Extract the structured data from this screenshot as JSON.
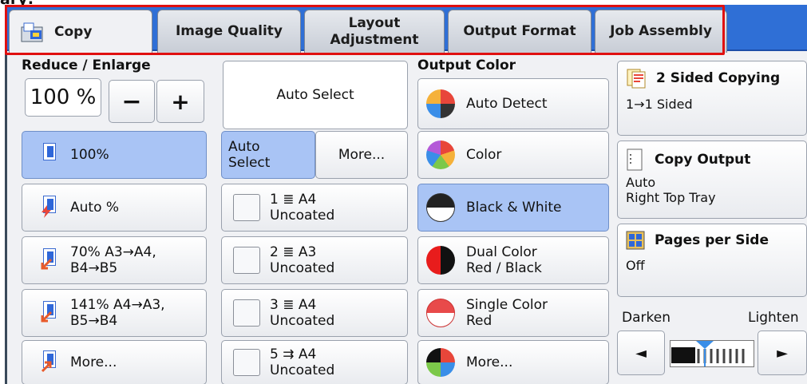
{
  "cropped_text": "ary:",
  "tabs": [
    {
      "label": "Copy"
    },
    {
      "label": "Image Quality"
    },
    {
      "label": "Layout\nAdjustment"
    },
    {
      "label": "Output Format"
    },
    {
      "label": "Job Assembly"
    }
  ],
  "reduce_enlarge": {
    "title": "Reduce / Enlarge",
    "value": "100 %",
    "minus": "−",
    "plus": "+",
    "options": [
      {
        "label": "100%",
        "selected": true
      },
      {
        "label": "Auto %",
        "selected": false
      },
      {
        "label": "70% A3→A4,\nB4→B5",
        "selected": false
      },
      {
        "label": "141% A4→A3,\nB5→B4",
        "selected": false
      },
      {
        "label": "More...",
        "selected": false
      }
    ]
  },
  "paper_supply": {
    "top": "Auto Select",
    "auto_select": "Auto\nSelect",
    "more": "More...",
    "trays": [
      {
        "label": "1 ≣ A4\nUncoated"
      },
      {
        "label": "2 ≣ A3\nUncoated"
      },
      {
        "label": "3 ≣ A4\nUncoated"
      },
      {
        "label": "5 ⇉ A4\nUncoated"
      }
    ]
  },
  "output_color": {
    "title": "Output Color",
    "options": [
      {
        "label": "Auto Detect",
        "selected": false
      },
      {
        "label": "Color",
        "selected": false
      },
      {
        "label": "Black & White",
        "selected": true
      },
      {
        "label": "Dual Color\nRed / Black",
        "selected": false
      },
      {
        "label": "Single Color\nRed",
        "selected": false
      },
      {
        "label": "More...",
        "selected": false
      }
    ]
  },
  "right": {
    "two_sided": {
      "title": "2 Sided Copying",
      "value": "1→1 Sided"
    },
    "copy_output": {
      "title": "Copy Output",
      "value": "Auto\nRight Top Tray"
    },
    "pages_per_side": {
      "title": "Pages per Side",
      "value": "Off"
    },
    "darken": "Darken",
    "lighten": "Lighten",
    "left_arrow": "◄",
    "right_arrow": "►"
  },
  "colors": {
    "tab_bar": "#2f6fd6",
    "selected": "#a9c4f5",
    "highlight": "#e01010"
  }
}
